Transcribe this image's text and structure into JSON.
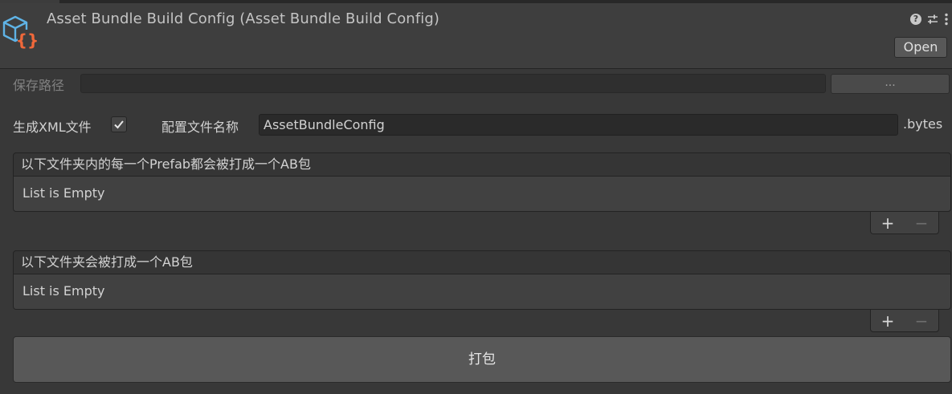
{
  "header": {
    "title": "Asset Bundle Build Config (Asset Bundle Build Config)",
    "open_label": "Open",
    "icons": [
      "asset-icon",
      "help-icon",
      "sliders-icon",
      "kebab-icon"
    ]
  },
  "save_path": {
    "label": "保存路径",
    "value": "",
    "browse_label": "..."
  },
  "xml": {
    "label": "生成XML文件",
    "checked": true
  },
  "config_name": {
    "label": "配置文件名称",
    "value": "AssetBundleConfig",
    "suffix": ".bytes"
  },
  "lists": [
    {
      "header": "以下文件夹内的每一个Prefab都会被打成一个AB包",
      "empty_text": "List is Empty",
      "add_label": "+",
      "remove_label": "−"
    },
    {
      "header": "以下文件夹会被打成一个AB包",
      "empty_text": "List is Empty",
      "add_label": "+",
      "remove_label": "−"
    }
  ],
  "build_label": "打包",
  "colors": {
    "background": "#383838",
    "header_bg": "#3e3e3e",
    "icon_blue": "#5fb3e6",
    "icon_orange": "#f0683a"
  }
}
